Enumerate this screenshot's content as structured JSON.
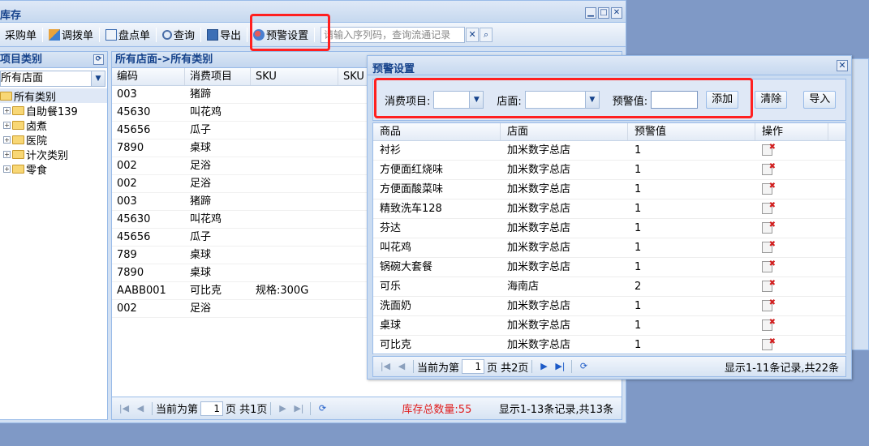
{
  "main": {
    "title": "库存",
    "toolbar": {
      "buttons": [
        {
          "label": "采购单",
          "icon": "purchase-icon"
        },
        {
          "label": "调拨单",
          "icon": "transfer-icon"
        },
        {
          "label": "盘点单",
          "icon": "inventory-icon"
        },
        {
          "label": "查询",
          "icon": "search-icon"
        },
        {
          "label": "导出",
          "icon": "export-icon"
        },
        {
          "label": "预警设置",
          "icon": "alert-settings-icon"
        }
      ],
      "search_placeholder": "请输入序列码，查询流通记录"
    },
    "left": {
      "header": "项目类别",
      "store_value": "所有店面",
      "tree": [
        {
          "label": "所有类别"
        },
        {
          "label": "自助餐139"
        },
        {
          "label": "卤煮"
        },
        {
          "label": "医院"
        },
        {
          "label": "计次类别"
        },
        {
          "label": "零食"
        }
      ]
    },
    "grid": {
      "header": "所有店面->所有类别",
      "columns": [
        "编码",
        "消费项目",
        "SKU",
        "SKU"
      ],
      "rows": [
        {
          "code": "003",
          "item": "猪蹄",
          "sku": ""
        },
        {
          "code": "45630",
          "item": "叫花鸡",
          "sku": ""
        },
        {
          "code": "45656",
          "item": "瓜子",
          "sku": ""
        },
        {
          "code": "7890",
          "item": "桌球",
          "sku": ""
        },
        {
          "code": "002",
          "item": "足浴",
          "sku": ""
        },
        {
          "code": "002",
          "item": "足浴",
          "sku": ""
        },
        {
          "code": "003",
          "item": "猪蹄",
          "sku": ""
        },
        {
          "code": "45630",
          "item": "叫花鸡",
          "sku": ""
        },
        {
          "code": "45656",
          "item": "瓜子",
          "sku": ""
        },
        {
          "code": "789",
          "item": "桌球",
          "sku": ""
        },
        {
          "code": "7890",
          "item": "桌球",
          "sku": ""
        },
        {
          "code": "AABB001",
          "item": "可比克",
          "sku": "规格:300G"
        },
        {
          "code": "002",
          "item": "足浴",
          "sku": ""
        }
      ],
      "pager": {
        "prefix": "当前为第",
        "page": "1",
        "suffix": "页 共1页",
        "total_label": "库存总数量:55",
        "summary": "显示1-13条记录,共13条"
      }
    }
  },
  "dialog": {
    "title": "预警设置",
    "form": {
      "item_label": "消费项目:",
      "store_label": "店面:",
      "threshold_label": "预警值:",
      "add_label": "添加",
      "clear_label": "清除",
      "import_label": "导入"
    },
    "columns": [
      "商品",
      "店面",
      "预警值",
      "操作"
    ],
    "rows": [
      {
        "product": "衬衫",
        "store": "加米数字总店",
        "value": "1"
      },
      {
        "product": "方便面红烧味",
        "store": "加米数字总店",
        "value": "1"
      },
      {
        "product": "方便面酸菜味",
        "store": "加米数字总店",
        "value": "1"
      },
      {
        "product": "精致洗车128",
        "store": "加米数字总店",
        "value": "1"
      },
      {
        "product": "芬达",
        "store": "加米数字总店",
        "value": "1"
      },
      {
        "product": "叫花鸡",
        "store": "加米数字总店",
        "value": "1"
      },
      {
        "product": "锅碗大套餐",
        "store": "加米数字总店",
        "value": "1"
      },
      {
        "product": "可乐",
        "store": "海南店",
        "value": "2"
      },
      {
        "product": "洗面奶",
        "store": "加米数字总店",
        "value": "1"
      },
      {
        "product": "桌球",
        "store": "加米数字总店",
        "value": "1"
      },
      {
        "product": "可比克",
        "store": "加米数字总店",
        "value": "1"
      }
    ],
    "pager": {
      "prefix": "当前为第",
      "page": "1",
      "suffix": "页 共2页",
      "summary": "显示1-11条记录,共22条"
    }
  },
  "colors": {
    "highlight": "#ff2020",
    "total_text": "#e02020"
  }
}
